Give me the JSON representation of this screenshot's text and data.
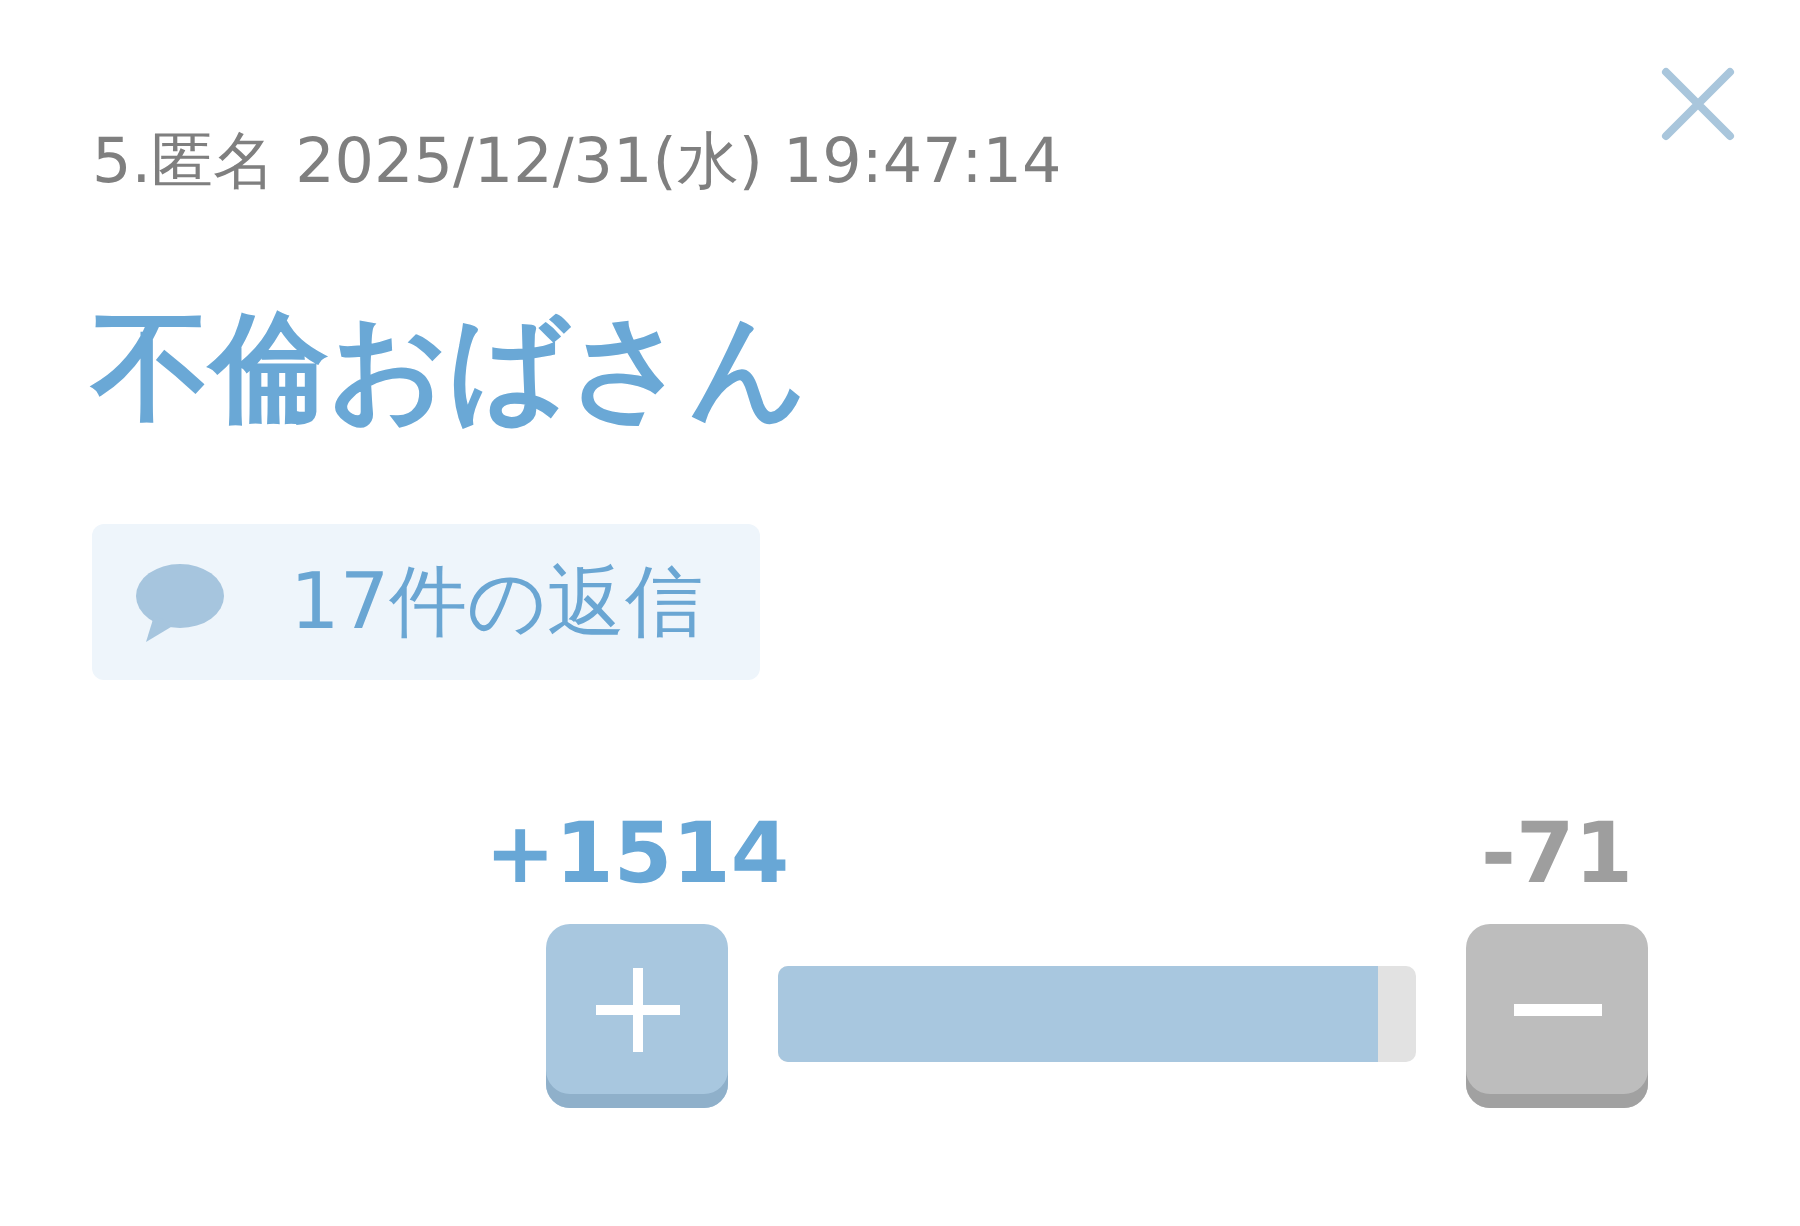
{
  "post": {
    "poster": "5.匿名",
    "date": "2025/12/31(水)",
    "time": "19:47:14",
    "title": "不倫おばさん",
    "replies": "17件の返信"
  },
  "votes": {
    "up": "+1514",
    "down": "-71",
    "level": 0.94
  }
}
